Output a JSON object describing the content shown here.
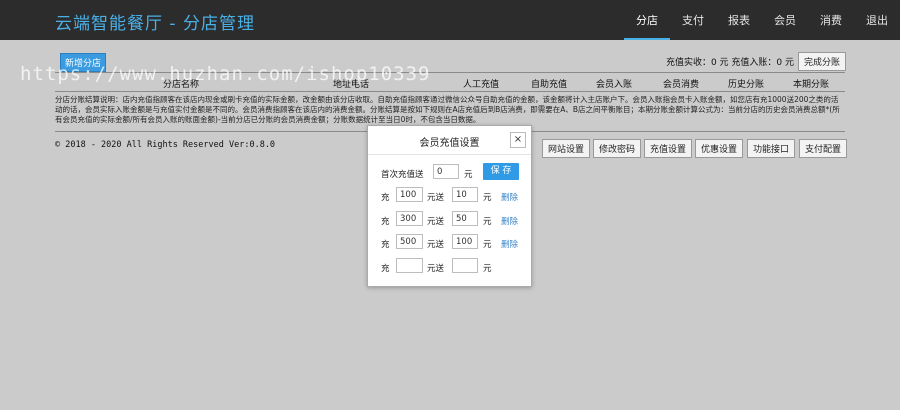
{
  "header": {
    "title": "云端智能餐厅  -  分店管理",
    "nav": [
      "分店",
      "支付",
      "报表",
      "会员",
      "消费",
      "退出"
    ],
    "active_index": 0
  },
  "watermark": "https://www.huzhan.com/ishop10339",
  "toolbar": {
    "new_branch": "新增分店",
    "summary": "充值实收：0 元  充值入账：0 元",
    "finish_split": "完成分账"
  },
  "tabs": [
    "分店名称",
    "地址电话",
    "人工充值",
    "自助充值",
    "会员入账",
    "会员消费",
    "历史分账",
    "本期分账"
  ],
  "description": "分店分账结算说明：店内充值指顾客在该店内现金或刷卡充值的实际金额，改金额由该分店收取。自助充值指顾客通过微信公众号自助充值的金额，该金额将计入主店账户下。会员入账指会员卡入账金额，如您店有充1000送200之类的活动的话，会员实际入账金额是与充值实付金额是不同的。会员消费指顾客在该店内的消费金额。分账结算是按如下规则在A店充值后到B店消费，即需要在A、B店之间平衡账目；本期分账金额计算公式为：当前分店的历史会员消费总额*(所有会员充值的实际金额/所有会员入账的账面金额)-当前分店已分账的会员消费金额；分账数据统计至当日0时，不包含当日数据。",
  "footer": {
    "copyright": "© 2018 - 2020 All Rights Reserved Ver:0.8.0",
    "buttons": [
      "网站设置",
      "修改密码",
      "充值设置",
      "优惠设置",
      "功能接口",
      "支付配置"
    ]
  },
  "modal": {
    "title": "会员充值设置",
    "close": "×",
    "first_label": "首次充值送",
    "first_value": "0",
    "unit": "元",
    "save": "保 存",
    "charge_label": "充",
    "give_label": "元送",
    "delete_label": "删除",
    "rules": [
      {
        "charge": "100",
        "give": "10"
      },
      {
        "charge": "300",
        "give": "50"
      },
      {
        "charge": "500",
        "give": "100"
      },
      {
        "charge": "",
        "give": ""
      }
    ]
  }
}
